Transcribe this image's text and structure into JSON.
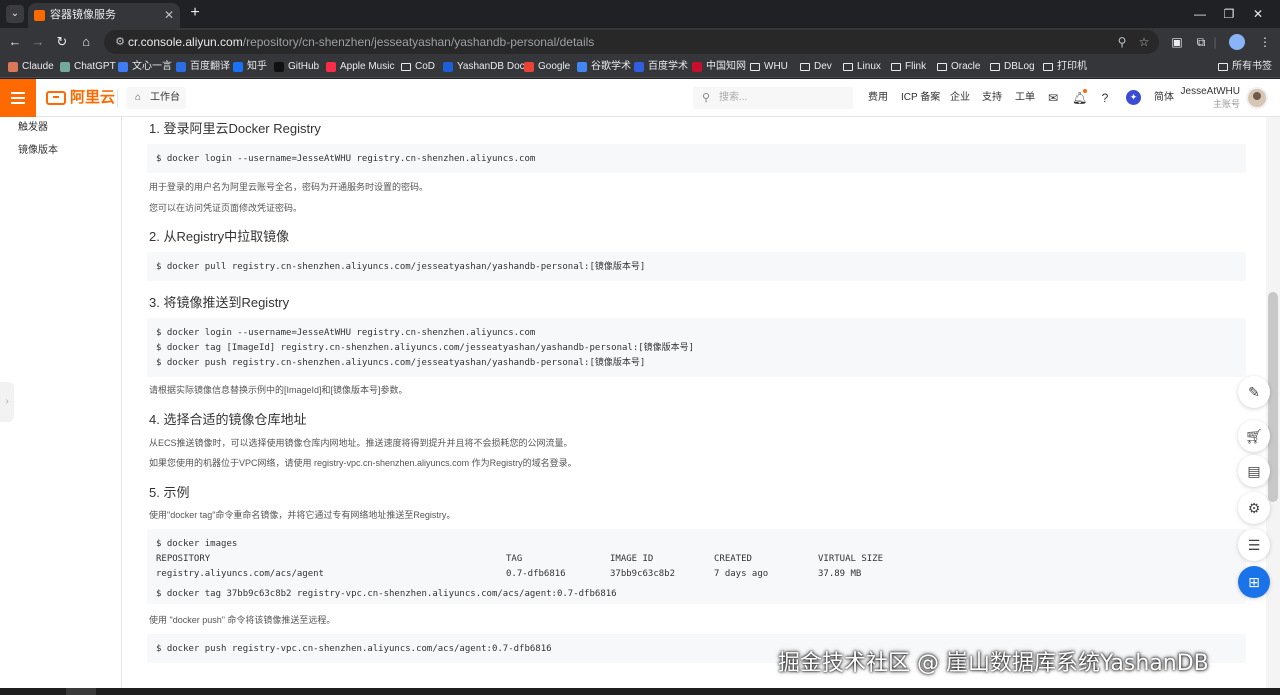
{
  "browser": {
    "tab_title": "容器镜像服务",
    "url_host": "cr.console.aliyun.com",
    "url_path": "/repository/cn-shenzhen/jesseatyashan/yashandb-personal/details",
    "bookmarks": [
      {
        "label": "Claude",
        "color": "#d97757"
      },
      {
        "label": "ChatGPT",
        "color": "#74aa9c"
      },
      {
        "label": "文心一言",
        "color": "#3d7cf5"
      },
      {
        "label": "百度翻译",
        "color": "#2b6de5"
      },
      {
        "label": "知乎",
        "color": "#1772f6"
      },
      {
        "label": "GitHub",
        "color": "#111111"
      },
      {
        "label": "Apple Music",
        "color": "#fa2d48"
      },
      {
        "label": "CoD",
        "folder": true
      },
      {
        "label": "YashanDB Doc",
        "color": "#1c5fd6"
      },
      {
        "label": "Google",
        "color": "#ea4335"
      },
      {
        "label": "谷歌学术",
        "color": "#4285f4"
      },
      {
        "label": "百度学术",
        "color": "#2f5fe0"
      },
      {
        "label": "中国知网",
        "color": "#c8102e"
      },
      {
        "label": "WHU",
        "folder": true
      },
      {
        "label": "Dev",
        "folder": true
      },
      {
        "label": "Linux",
        "folder": true
      },
      {
        "label": "Flink",
        "folder": true
      },
      {
        "label": "Oracle",
        "folder": true
      },
      {
        "label": "DBLog",
        "folder": true
      },
      {
        "label": "打印机",
        "folder": true
      }
    ],
    "all_bookmarks": "所有书签"
  },
  "header": {
    "logo_text": "阿里云",
    "workbench": "工作台",
    "search_placeholder": "搜索...",
    "links": [
      "费用",
      "ICP 备案",
      "企业",
      "支持",
      "工单"
    ],
    "lang": "简体",
    "account_name": "JesseAtWHU",
    "account_role": "主账号"
  },
  "sidebar": {
    "items": [
      "触发器",
      "镜像版本"
    ]
  },
  "content": {
    "s1_title": "1. 登录阿里云Docker Registry",
    "s1_code": "$ docker login --username=JesseAtWHU registry.cn-shenzhen.aliyuncs.com",
    "s1_p1": "用于登录的用户名为阿里云账号全名，密码为开通服务时设置的密码。",
    "s1_p2": "您可以在访问凭证页面修改凭证密码。",
    "s2_title": "2. 从Registry中拉取镜像",
    "s2_code": "$ docker pull registry.cn-shenzhen.aliyuncs.com/jesseatyashan/yashandb-personal:[镜像版本号]",
    "s3_title": "3. 将镜像推送到Registry",
    "s3_code": [
      "$ docker login --username=JesseAtWHU registry.cn-shenzhen.aliyuncs.com",
      "$ docker tag [ImageId] registry.cn-shenzhen.aliyuncs.com/jesseatyashan/yashandb-personal:[镜像版本号]",
      "$ docker push registry.cn-shenzhen.aliyuncs.com/jesseatyashan/yashandb-personal:[镜像版本号]"
    ],
    "s3_p1": "请根据实际镜像信息替换示例中的[ImageId]和[镜像版本号]参数。",
    "s4_title": "4. 选择合适的镜像仓库地址",
    "s4_p1": "从ECS推送镜像时，可以选择使用镜像仓库内网地址。推送速度将得到提升并且将不会损耗您的公网流量。",
    "s4_p2": "如果您使用的机器位于VPC网络，请使用 registry-vpc.cn-shenzhen.aliyuncs.com 作为Registry的域名登录。",
    "s5_title": "5. 示例",
    "s5_p1": "使用\"docker tag\"命令重命名镜像，并将它通过专有网络地址推送至Registry。",
    "s5_cmd1": "$ docker images",
    "s5_table_headers": [
      "REPOSITORY",
      "TAG",
      "IMAGE ID",
      "CREATED",
      "VIRTUAL SIZE"
    ],
    "s5_table_row": [
      "registry.aliyuncs.com/acs/agent",
      "0.7-dfb6816",
      "37bb9c63c8b2",
      "7 days ago",
      "37.89 MB"
    ],
    "s5_cmd2": "$ docker tag 37bb9c63c8b2 registry-vpc.cn-shenzhen.aliyuncs.com/acs/agent:0.7-dfb6816",
    "s5_p2": "使用 \"docker push\" 命令将该镜像推送至远程。",
    "s5_cmd3": "$ docker push registry-vpc.cn-shenzhen.aliyuncs.com/acs/agent:0.7-dfb6816"
  },
  "watermark": "掘金技术社区 @ 崖山数据库系统YashanDB",
  "colors": {
    "brand": "#ff6a00",
    "active_float": "#1a73e8"
  }
}
